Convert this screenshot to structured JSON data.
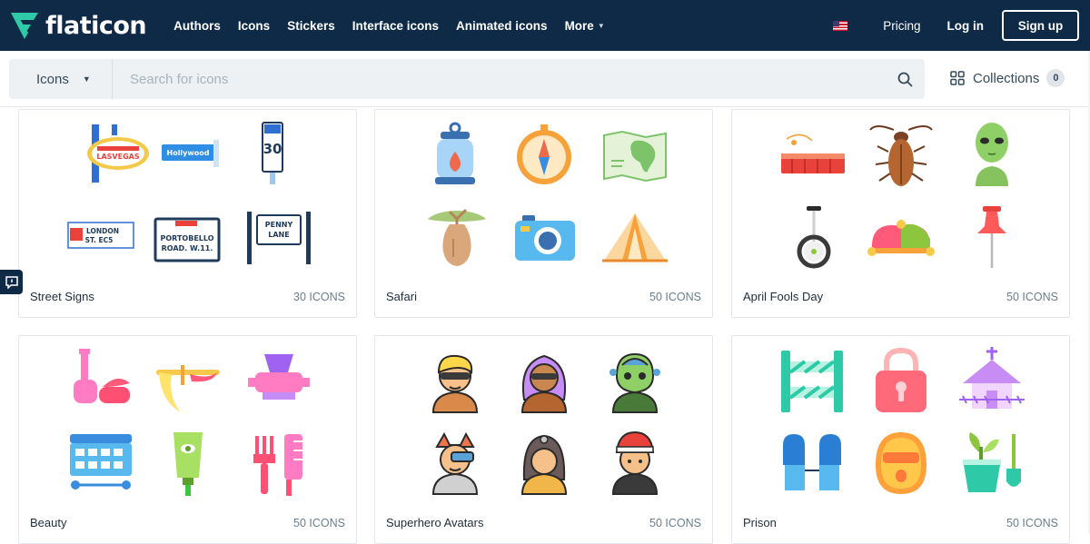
{
  "brand": {
    "name": "flaticon",
    "color": "#0e2a47",
    "accent": "#2ec9a6"
  },
  "nav": {
    "links": [
      "Authors",
      "Icons",
      "Stickers",
      "Interface icons",
      "Animated icons",
      "More"
    ],
    "more_icon": "chevron-down-icon",
    "flag_icon": "us-flag-icon",
    "pricing": "Pricing",
    "login": "Log in",
    "signup": "Sign up"
  },
  "search": {
    "type": "Icons",
    "placeholder": "Search for icons",
    "value": "",
    "collections_label": "Collections",
    "collections_count": "0"
  },
  "cards": [
    {
      "title": "Street Signs",
      "count": "30 ICONS",
      "icons": [
        "las-vegas-sign-icon",
        "hollywood-street-sign-icon",
        "speed-limit-30-sign-icon",
        "london-street-sign-icon",
        "portobello-road-sign-icon",
        "penny-lane-sign-icon"
      ]
    },
    {
      "title": "Safari",
      "count": "50 ICONS",
      "icons": [
        "lantern-icon",
        "compass-icon",
        "africa-map-icon",
        "baobab-tree-icon",
        "camera-icon",
        "tent-icon"
      ]
    },
    {
      "title": "April Fools Day",
      "count": "50 ICONS",
      "icons": [
        "whoopee-cushion-icon",
        "cockroach-icon",
        "alien-icon",
        "unicycle-icon",
        "jester-hat-icon",
        "push-pin-icon"
      ]
    },
    {
      "title": "Beauty",
      "count": "50 ICONS",
      "icons": [
        "perfume-bottles-icon",
        "eyelash-curler-icon",
        "cosmetic-icon",
        "makeup-palette-icon",
        "cream-tube-icon",
        "comb-icon"
      ]
    },
    {
      "title": "Superhero Avatars",
      "count": "50 ICONS",
      "icons": [
        "masked-hero-blonde-icon",
        "masked-hero-purple-hair-icon",
        "alien-hero-icon",
        "cyborg-hero-icon",
        "helmet-hero-icon",
        "cap-hero-icon"
      ]
    },
    {
      "title": "Prison",
      "count": "50 ICONS",
      "icons": [
        "barrier-icon",
        "padlock-icon",
        "prison-tower-icon",
        "boxing-gloves-icon",
        "balaclava-mask-icon",
        "plant-and-shovel-icon"
      ]
    }
  ]
}
